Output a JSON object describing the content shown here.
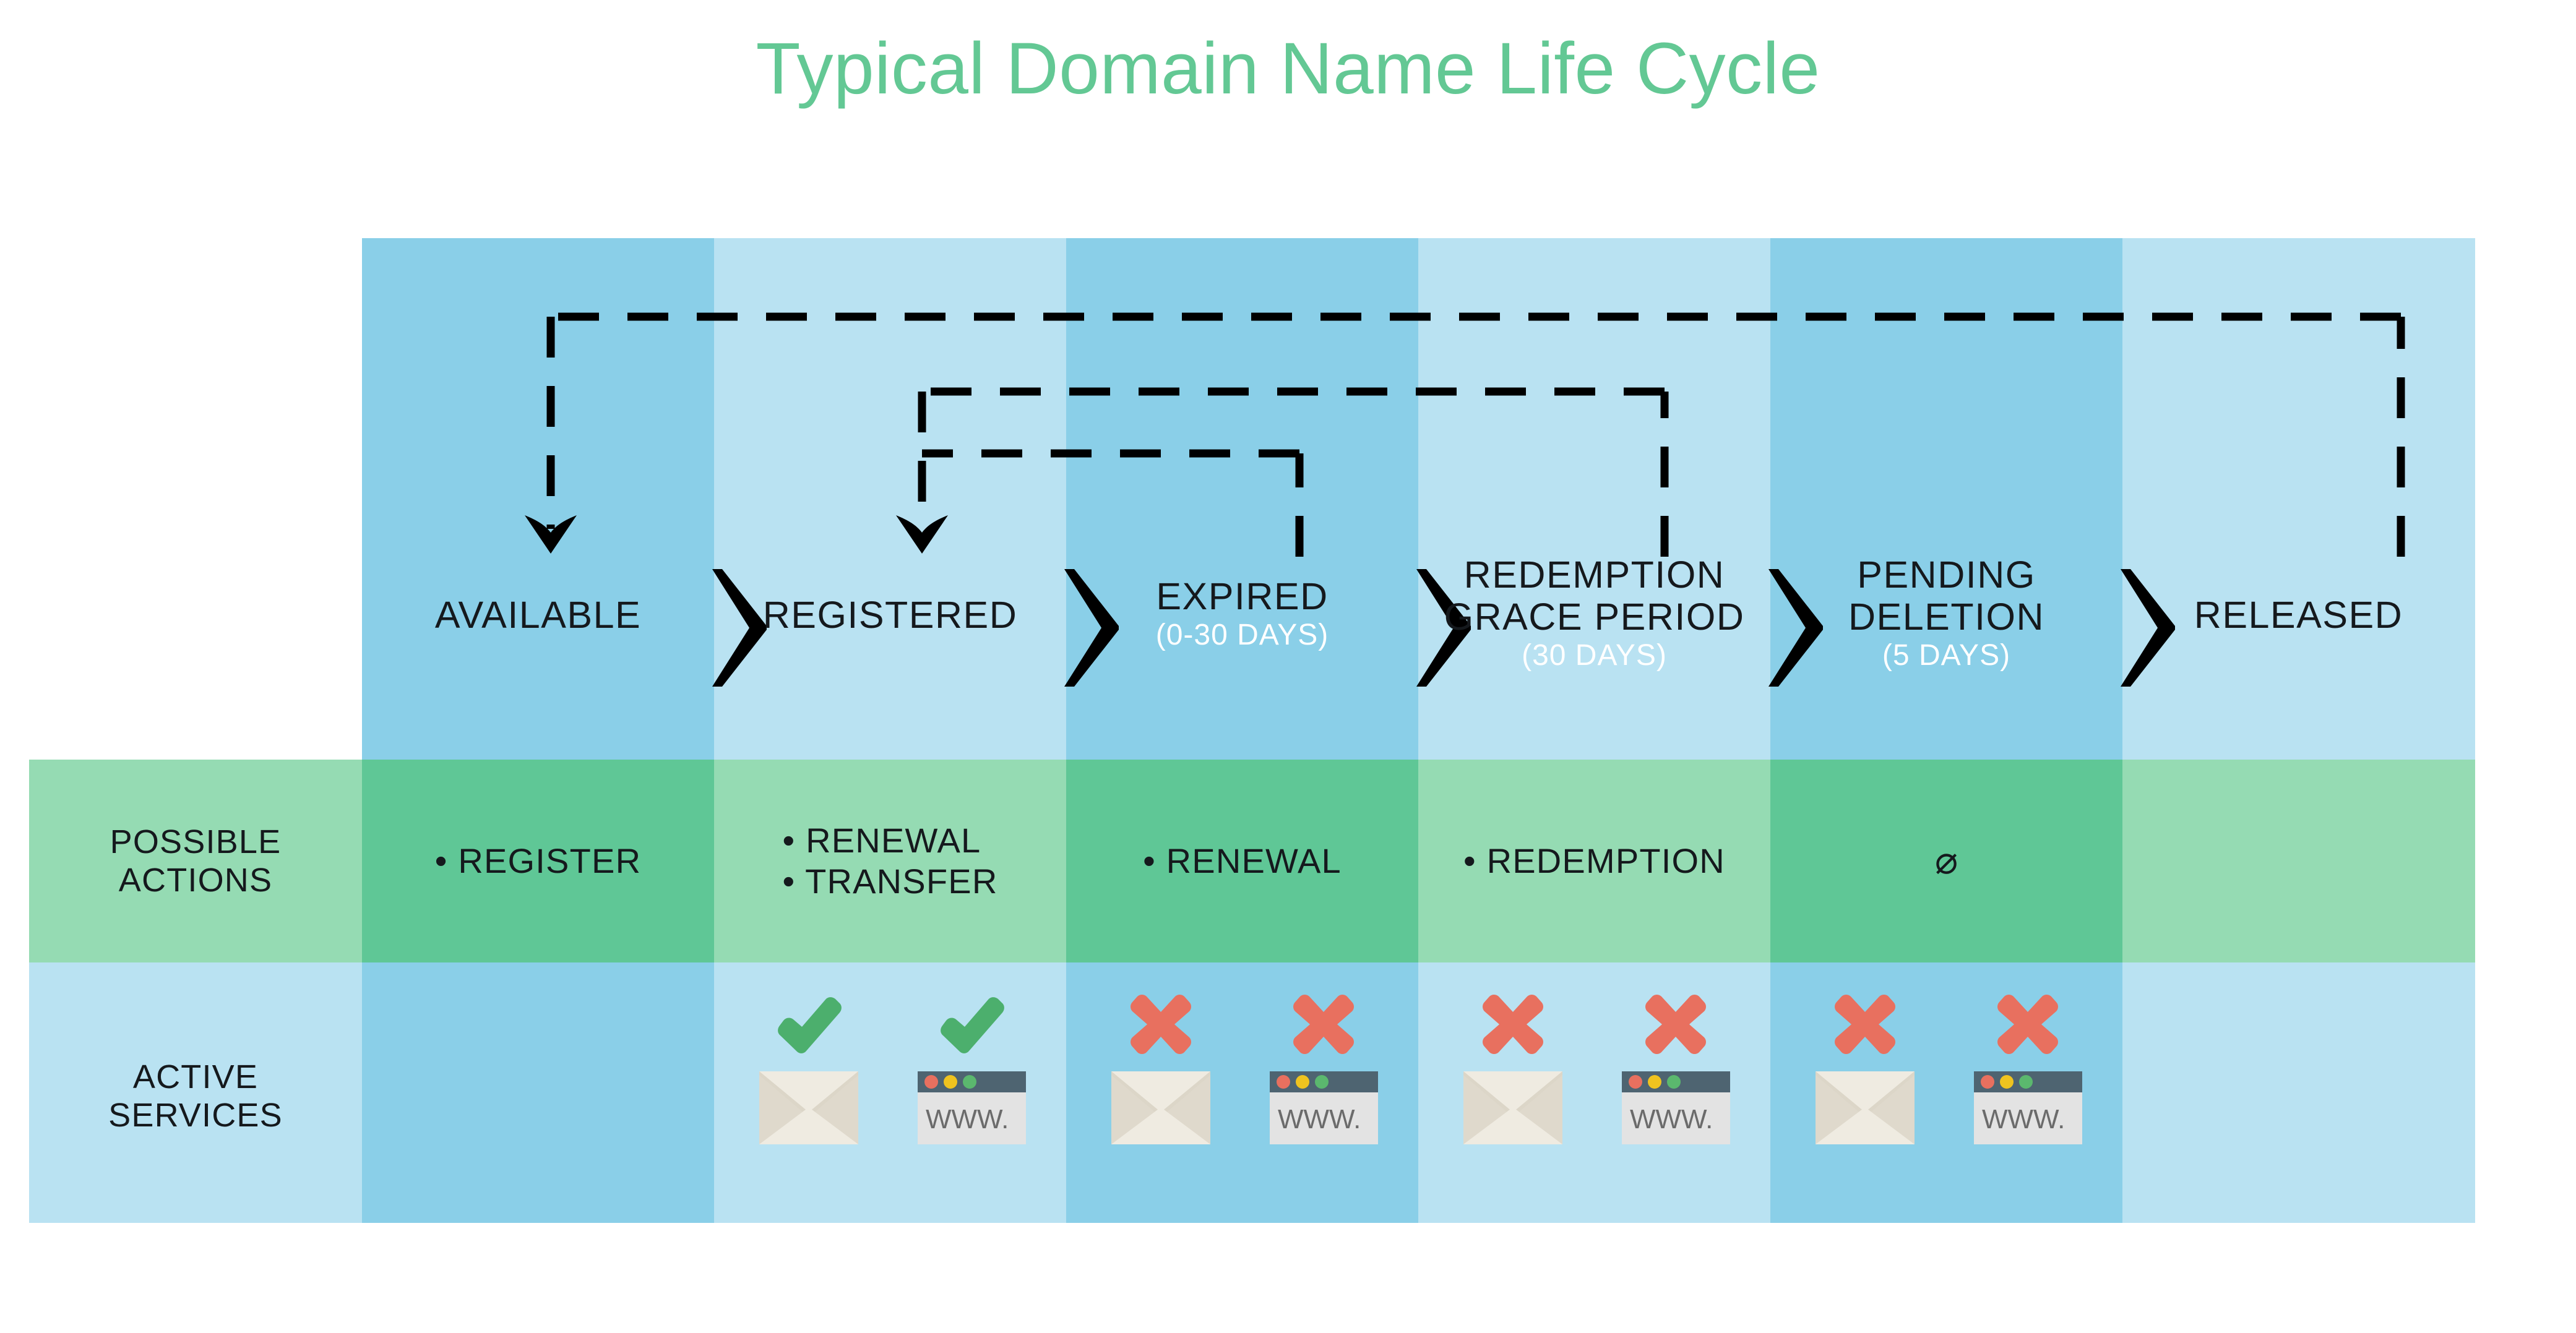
{
  "title": "Typical Domain Name Life Cycle",
  "colors": {
    "title_green": "#63c894",
    "blue_dark": "#8ACFE8",
    "blue_light": "#B9E2F2",
    "green_dark": "#5FC796",
    "green_light": "#95DBB3",
    "check_green": "#4CAF6D",
    "cross_red": "#E8705F",
    "arrow_black": "#000000",
    "subtitle_white": "#FFFFFF",
    "browser_bar": "#4E6471",
    "browser_body": "#E3E3E3",
    "www_text": "#6B6B6B",
    "envelope": "#EFEBE1",
    "dot_red": "#E8705F",
    "dot_yellow": "#EFC31F",
    "dot_green": "#5BB86E"
  },
  "row_labels": {
    "possible_actions": "POSSIBLE\nACTIONS",
    "possible_actions_line1": "POSSIBLE",
    "possible_actions_line2": "ACTIONS",
    "active_services": "ACTIVE\nSERVICES",
    "active_services_line1": "ACTIVE",
    "active_services_line2": "SERVICES"
  },
  "separator_icon": "chevron-right-icon",
  "stages": [
    {
      "name": "AVAILABLE",
      "subtitle": "",
      "actions": [
        "• REGISTER"
      ],
      "actions_none": false,
      "services": []
    },
    {
      "name": "REGISTERED",
      "subtitle": "",
      "actions": [
        "• RENEWAL",
        "• TRANSFER"
      ],
      "actions_none": false,
      "services": [
        {
          "icon": "envelope-icon",
          "status": "check",
          "label": ""
        },
        {
          "icon": "browser-window-icon",
          "status": "check",
          "label": "WWW."
        }
      ]
    },
    {
      "name": "EXPIRED",
      "subtitle": "(0-30 DAYS)",
      "actions": [
        "• RENEWAL"
      ],
      "actions_none": false,
      "services": [
        {
          "icon": "envelope-icon",
          "status": "cross",
          "label": ""
        },
        {
          "icon": "browser-window-icon",
          "status": "cross",
          "label": "WWW."
        }
      ]
    },
    {
      "name": "REDEMPTION GRACE PERIOD",
      "name_line1": "REDEMPTION",
      "name_line2": "GRACE PERIOD",
      "subtitle": "(30 DAYS)",
      "actions": [
        "• REDEMPTION"
      ],
      "actions_none": false,
      "services": [
        {
          "icon": "envelope-icon",
          "status": "cross",
          "label": ""
        },
        {
          "icon": "browser-window-icon",
          "status": "cross",
          "label": "WWW."
        }
      ]
    },
    {
      "name": "PENDING DELETION",
      "name_line1": "PENDING",
      "name_line2": "DELETION",
      "subtitle": "(5 DAYS)",
      "actions": [],
      "actions_none": true,
      "actions_none_symbol": "⌀",
      "services": [
        {
          "icon": "envelope-icon",
          "status": "cross",
          "label": ""
        },
        {
          "icon": "browser-window-icon",
          "status": "cross",
          "label": "WWW."
        }
      ]
    },
    {
      "name": "RELEASED",
      "subtitle": "",
      "actions": [],
      "actions_none": false,
      "services": []
    }
  ],
  "transitions": [
    {
      "from": "RELEASED",
      "to": "AVAILABLE",
      "style": "dashed",
      "label": ""
    },
    {
      "from": "REDEMPTION GRACE PERIOD",
      "to": "REGISTERED",
      "style": "dashed",
      "label": ""
    },
    {
      "from": "EXPIRED",
      "to": "REGISTERED",
      "style": "dashed",
      "label": ""
    }
  ]
}
